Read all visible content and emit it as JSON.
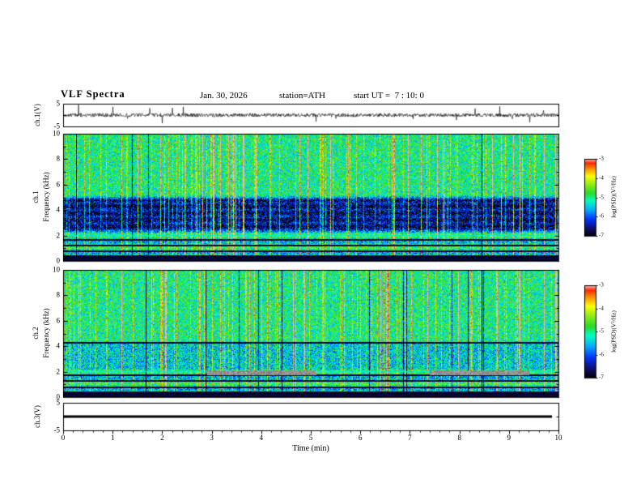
{
  "header": {
    "title": "VLF Spectra",
    "date": "Jan. 30, 2026",
    "station": "station=ATH",
    "start_ut": "start UT =  7 : 10: 0"
  },
  "panels": {
    "ch1_wave": {
      "label": "ch.1(V)",
      "ymin": -5,
      "ymax": 5,
      "yticks": [
        5,
        -5
      ]
    },
    "ch1_spec": {
      "channel": "ch.1",
      "axis_label": "Frequency (kHz)",
      "ymin": 0,
      "ymax": 10,
      "yticks": [
        0,
        2,
        4,
        6,
        8,
        10
      ]
    },
    "ch2_spec": {
      "channel": "ch.2",
      "axis_label": "Frequency (kHz)",
      "ymin": 0,
      "ymax": 10,
      "yticks": [
        0,
        2,
        4,
        6,
        8,
        10
      ]
    },
    "ch3_wave": {
      "label": "ch.3(V)",
      "ymin": -5,
      "ymax": 5,
      "yticks": [
        5,
        -5
      ]
    }
  },
  "xaxis": {
    "label": "Time (min)",
    "min": 0,
    "max": 10,
    "ticks": [
      0,
      1,
      2,
      3,
      4,
      5,
      6,
      7,
      8,
      9,
      10
    ]
  },
  "colorbar": {
    "label": "log(PSD)(V²/Hz)",
    "min": -7,
    "max": -3,
    "ticks": [
      -3,
      -4,
      -5,
      -6,
      -7
    ]
  },
  "chart_data": [
    {
      "type": "line",
      "name": "ch.1 time series",
      "ylabel": "ch.1(V)",
      "xlim": [
        0,
        10
      ],
      "ylim": [
        -5,
        5
      ],
      "description": "Broadband receiver output: continuous noise of roughly ±1 V with frequent impulsive sferic spikes reaching about ±4 V throughout the 10-minute record."
    },
    {
      "type": "heatmap",
      "name": "ch.1 spectrogram",
      "xlabel": "Time (min)",
      "ylabel": "ch.1 Frequency (kHz)",
      "zlabel": "log(PSD)(V²/Hz)",
      "xlim": [
        0,
        10
      ],
      "ylim": [
        0,
        10
      ],
      "zlim": [
        -7,
        -3
      ],
      "colormap": "jet with black minimum",
      "features": [
        "background PSD near -5 (green/cyan speckle) from ~0.5 to 10 kHz",
        "dense narrow vertical broadband streaks (sferics) in yellow/red at irregular times over the whole record",
        "suppressed dark-blue band (PSD near -6.5) between about 2.3 and 5 kHz with horizontal striations",
        "black low-power band below ~0.5 kHz and narrow dark horizontal lines near 0.8, 1.25 and 1.7 kHz"
      ]
    },
    {
      "type": "heatmap",
      "name": "ch.2 spectrogram",
      "xlabel": "Time (min)",
      "ylabel": "ch.2 Frequency (kHz)",
      "zlabel": "log(PSD)(V²/Hz)",
      "xlim": [
        0,
        10
      ],
      "ylim": [
        0,
        10
      ],
      "zlim": [
        -7,
        -3
      ],
      "colormap": "jet with black minimum",
      "features": [
        "background PSD near -5 (green speckle) with slightly suppressed region 2.2-4.3 kHz",
        "strong vertical sferic streaks in red/yellow plus occasional dark columns",
        "horizontally banded structure below ~2.2 kHz with black lines near 0.8, 1.3 and 1.75 kHz and a dark line near 4.3 kHz",
        "gray interference patches near 2 kHz around t = 3-5 min and t = 7.5-9.3 min"
      ]
    },
    {
      "type": "line",
      "name": "ch.3 time series",
      "ylabel": "ch.3(V)",
      "xlim": [
        0,
        10
      ],
      "ylim": [
        -5,
        5
      ],
      "description": "Flat thick line at 0 V for the whole record (channel inactive)."
    }
  ]
}
